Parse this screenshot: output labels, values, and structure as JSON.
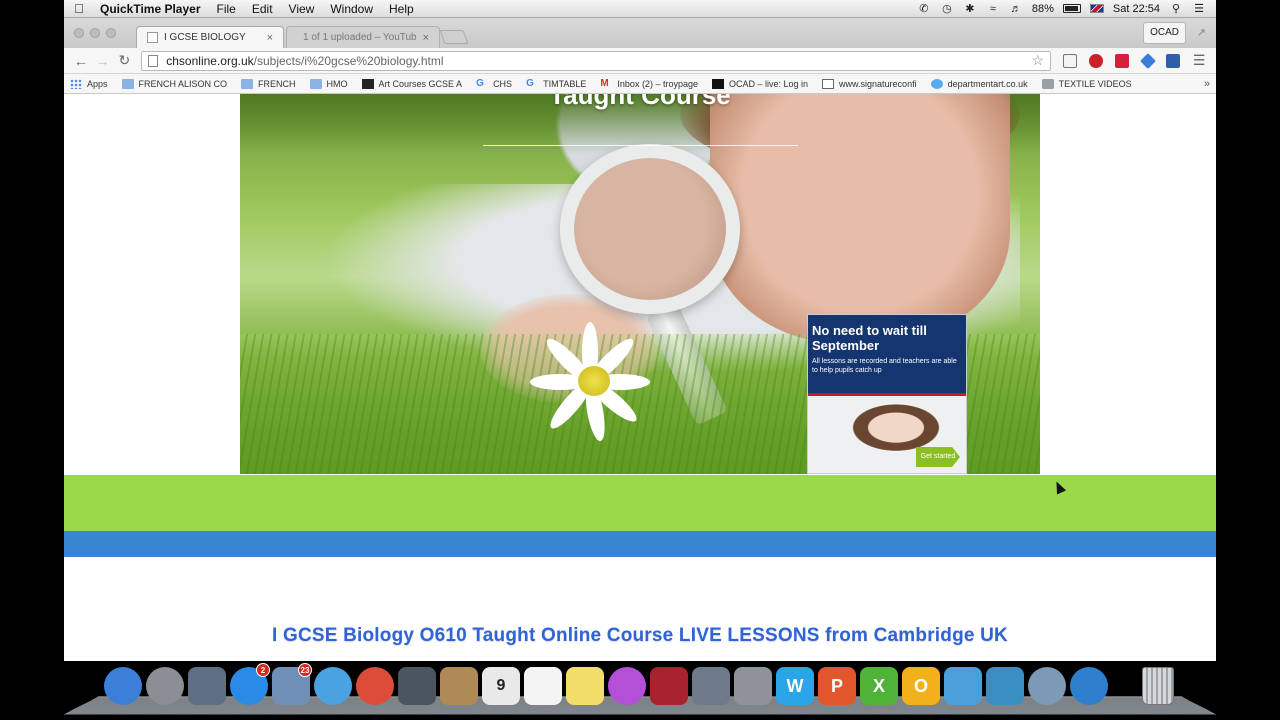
{
  "menubar": {
    "app_name": "QuickTime Player",
    "menus": [
      "File",
      "Edit",
      "View",
      "Window",
      "Help"
    ],
    "battery": "88%",
    "clock": "Sat 22:54"
  },
  "browser": {
    "tabs": [
      {
        "label": "I GCSE BIOLOGY",
        "active": true
      },
      {
        "label": "1 of 1 uploaded – YouTub",
        "active": false
      }
    ],
    "profile_button": "OCAD",
    "address": {
      "host": "chsonline.org.uk",
      "path": "/subjects/i%20gcse%20biology.html"
    },
    "bookmarks": [
      {
        "label": "Apps",
        "icon": "apps-grid-icon"
      },
      {
        "label": "FRENCH ALISON CO",
        "icon": "folder-icon"
      },
      {
        "label": "FRENCH",
        "icon": "folder-icon"
      },
      {
        "label": "HMO",
        "icon": "folder-icon"
      },
      {
        "label": "Art Courses GCSE A",
        "icon": "site-icon"
      },
      {
        "label": "CHS",
        "icon": "google-icon"
      },
      {
        "label": "TIMTABLE",
        "icon": "google-icon"
      },
      {
        "label": "Inbox (2) – troypage",
        "icon": "gmail-icon"
      },
      {
        "label": "OCAD – live: Log in",
        "icon": "site-icon"
      },
      {
        "label": "www.signatureconfi",
        "icon": "page-icon"
      },
      {
        "label": "departmentart.co.uk",
        "icon": "twitter-icon"
      },
      {
        "label": "TEXTILE VIDEOS",
        "icon": "puzzle-icon"
      }
    ],
    "bookmarks_overflow": "»"
  },
  "page": {
    "hero_title": "Taught Course",
    "ad": {
      "headline": "No need to wait till September",
      "subtext": "All lessons are recorded and teachers are able to help pupils catch up",
      "cta": "Get started"
    },
    "heading": "I GCSE Biology O610 Taught Online Course LIVE LESSONS from Cambridge UK"
  },
  "dock": {
    "items": [
      {
        "name": "finder-icon",
        "color": "#3b7fd9"
      },
      {
        "name": "launchpad-icon",
        "color": "#8a8f96"
      },
      {
        "name": "dashboard-icon",
        "color": "#5c6f84"
      },
      {
        "name": "app-store-icon",
        "color": "#2a8be6",
        "badge": "2"
      },
      {
        "name": "mail-icon",
        "color": "#6f8fb6",
        "badge": "23"
      },
      {
        "name": "safari-icon",
        "color": "#4aa3e0"
      },
      {
        "name": "chrome-icon",
        "color": "#dd4b39"
      },
      {
        "name": "facetime-icon",
        "color": "#4b5560"
      },
      {
        "name": "contacts-icon",
        "color": "#b08a55"
      },
      {
        "name": "calendar-icon",
        "color": "#e9e9e9",
        "label": "9"
      },
      {
        "name": "reminders-icon",
        "color": "#f4f4f4"
      },
      {
        "name": "notes-icon",
        "color": "#f2dc6a"
      },
      {
        "name": "itunes-icon",
        "color": "#b44fd8"
      },
      {
        "name": "photo-booth-icon",
        "color": "#a8232b"
      },
      {
        "name": "iphoto-icon",
        "color": "#6c7a8a"
      },
      {
        "name": "system-preferences-icon",
        "color": "#8d9399"
      },
      {
        "name": "word-icon",
        "color": "#2aa6e8",
        "label": "W"
      },
      {
        "name": "powerpoint-icon",
        "color": "#e2562b",
        "label": "P"
      },
      {
        "name": "excel-icon",
        "color": "#4fb33a",
        "label": "X"
      },
      {
        "name": "outlook-icon",
        "color": "#f2b11a",
        "label": "O"
      },
      {
        "name": "messenger-icon",
        "color": "#4a9fd8"
      },
      {
        "name": "remote-desktop-icon",
        "color": "#3a8fc2"
      },
      {
        "name": "network-icon",
        "color": "#7a9ab8"
      },
      {
        "name": "quicktime-icon",
        "color": "#2f7fcf"
      }
    ]
  }
}
